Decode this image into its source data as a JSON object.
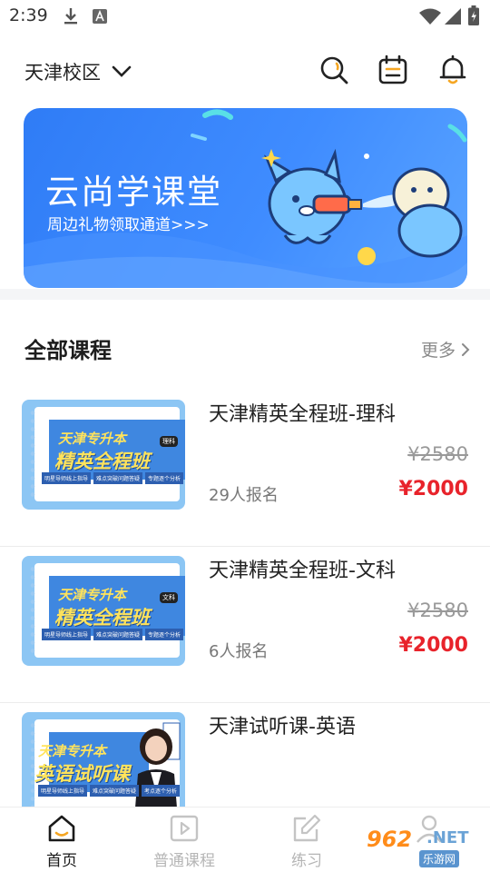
{
  "status_bar": {
    "time": "2:39",
    "icons": [
      "download-icon",
      "font-app-icon",
      "wifi-icon",
      "signal-icon",
      "battery-icon"
    ]
  },
  "header": {
    "campus_label": "天津校区",
    "icons": [
      "search-icon",
      "calendar-icon",
      "bell-icon"
    ]
  },
  "banner": {
    "title": "云尚学课堂",
    "subtitle": "周边礼物领取通道>>>"
  },
  "section": {
    "title": "全部课程",
    "more_label": "更多"
  },
  "courses": [
    {
      "title": "天津精英全程班-理科",
      "original_price": "¥2580",
      "enrolled": "29人报名",
      "price": "¥2000",
      "thumb": {
        "line1": "天津专升本",
        "line2": "精英全程班",
        "badge": "理科",
        "tags": [
          "明星导师线上指导",
          "难点突破问题答疑",
          "专题逐个分析"
        ]
      }
    },
    {
      "title": "天津精英全程班-文科",
      "original_price": "¥2580",
      "enrolled": "6人报名",
      "price": "¥2000",
      "thumb": {
        "line1": "天津专升本",
        "line2": "精英全程班",
        "badge": "文科",
        "tags": [
          "明星导师线上指导",
          "难点突破问题答疑",
          "专题逐个分析"
        ]
      }
    },
    {
      "title": "天津试听课-英语",
      "original_price": "",
      "enrolled": "",
      "price": "",
      "thumb": {
        "line1": "天津专升本",
        "line2": "英语试听课",
        "badge": "",
        "tags": [
          "明星导师线上指导",
          "难点突破问题答疑",
          "考点逐个分析"
        ]
      }
    }
  ],
  "tabbar": {
    "tabs": [
      {
        "label": "首页",
        "icon": "home-icon",
        "active": true
      },
      {
        "label": "普通课程",
        "icon": "video-course-icon",
        "active": false
      },
      {
        "label": "练习",
        "icon": "edit-practice-icon",
        "active": false
      },
      {
        "label": "",
        "icon": "profile-icon",
        "active": false
      }
    ]
  },
  "watermark": {
    "brand_number": "962",
    "brand_domain": ".NET",
    "brand_name": "乐游网"
  },
  "colors": {
    "accent_blue": "#3f8cff",
    "price_red": "#e8232b",
    "watermark_orange": "#ff8c1a"
  }
}
